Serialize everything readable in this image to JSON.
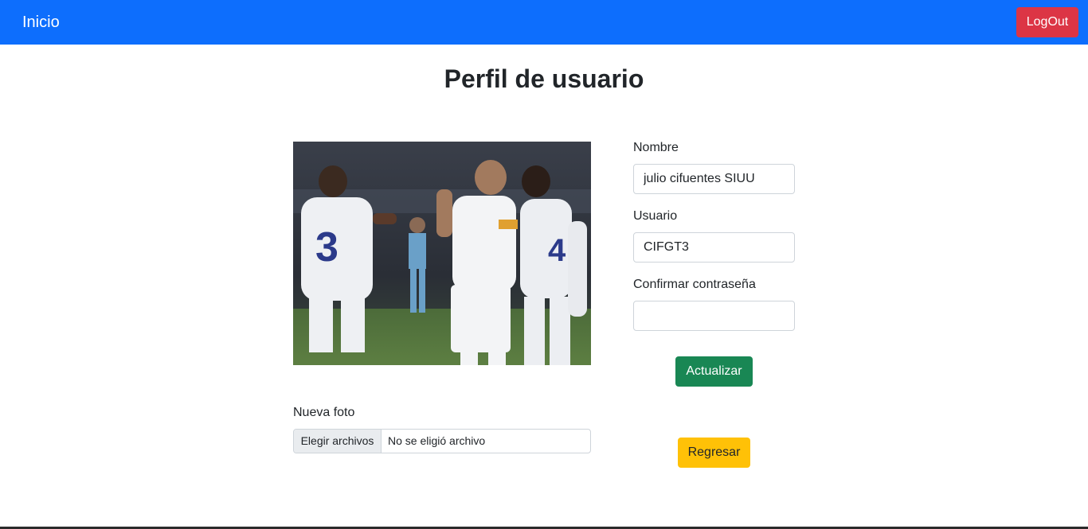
{
  "navbar": {
    "brand": "Inicio",
    "logout_label": "LogOut",
    "color": "#0d6efd"
  },
  "page_title": "Perfil de usuario",
  "profile_photo": {
    "subject": "football-players-celebrating"
  },
  "form": {
    "nombre_label": "Nombre",
    "nombre_value": "julio cifuentes SIUU",
    "usuario_label": "Usuario",
    "usuario_value": "CIFGT3",
    "confirm_label": "Confirmar contraseña",
    "confirm_value": "",
    "update_label": "Actualizar",
    "back_label": "Regresar"
  },
  "upload": {
    "label": "Nueva foto",
    "button_label": "Elegir archivos",
    "status": "No se eligió archivo"
  },
  "colors": {
    "logout": "#dc3545",
    "update": "#198754",
    "back": "#ffc107"
  }
}
